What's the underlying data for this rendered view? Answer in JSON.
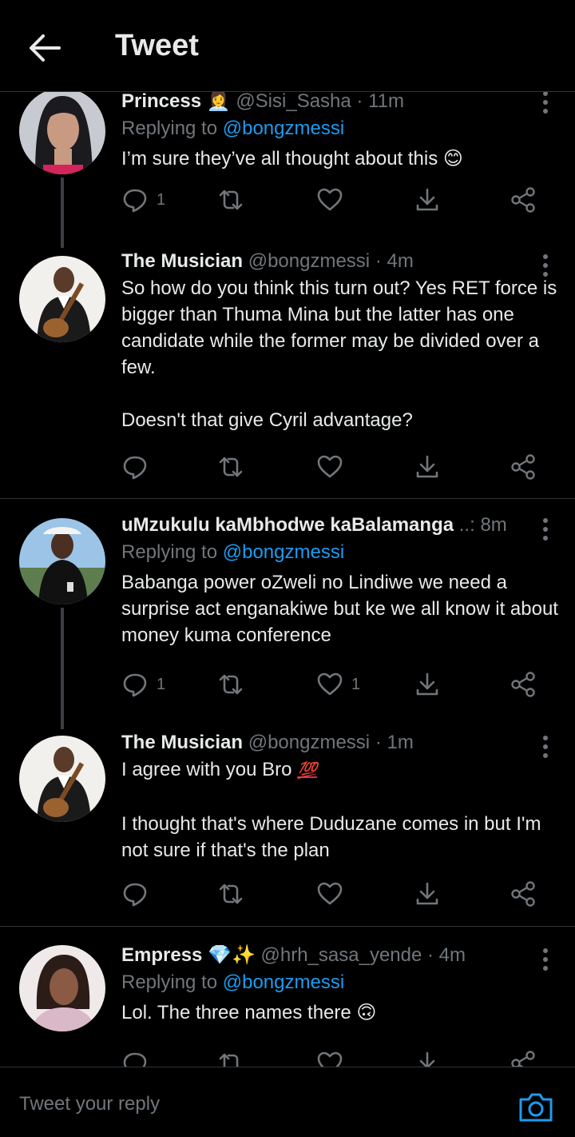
{
  "header": {
    "title": "Tweet"
  },
  "tweets": [
    {
      "name": "Princess",
      "name_emoji": "👩‍💼",
      "handle": "@Sisi_Sasha",
      "time": "· 11m",
      "replying_label": "Replying to",
      "replying_to": "@bongzmessi",
      "text": "I’m sure they’ve all thought about this",
      "text_emoji": "😊",
      "replies": "1",
      "retweets": "",
      "likes": ""
    },
    {
      "name": "The Musician",
      "handle": "@bongzmessi",
      "time": "· 4m",
      "text": "So how do you think this turn out? Yes RET force is bigger than Thuma Mina but the latter has one candidate while the former may be divided over a few.\n\nDoesn't that give Cyril advantage?",
      "replies": "",
      "retweets": "",
      "likes": ""
    },
    {
      "name": "uMzukulu kaMbhodwe kaBalamanga",
      "name_suffix": "..:",
      "time": "8m",
      "replying_label": "Replying to",
      "replying_to": "@bongzmessi",
      "text": "Babanga power oZweli no Lindiwe we need a surprise act enganakiwe but ke we all know it about money kuma conference",
      "replies": "1",
      "retweets": "",
      "likes": "1"
    },
    {
      "name": "The Musician",
      "handle": "@bongzmessi",
      "time": "· 1m",
      "text_line1": "I agree with you Bro",
      "text_emoji": "💯",
      "text_rest": "I thought that's where Duduzane comes in but I'm not sure if that's the plan",
      "replies": "",
      "retweets": "",
      "likes": ""
    },
    {
      "name": "Empress",
      "name_emoji": "💎✨",
      "handle": "@hrh_sasa_yende",
      "time": "· 4m",
      "replying_label": "Replying to",
      "replying_to": "@bongzmessi",
      "text": "Lol. The three names there",
      "text_emoji": "🙃"
    }
  ],
  "footer": {
    "reply_placeholder": "Tweet your reply"
  },
  "colors": {
    "background": "#000000",
    "link": "#1d9bf0",
    "muted": "#71767b",
    "text": "#e7e9ea"
  }
}
